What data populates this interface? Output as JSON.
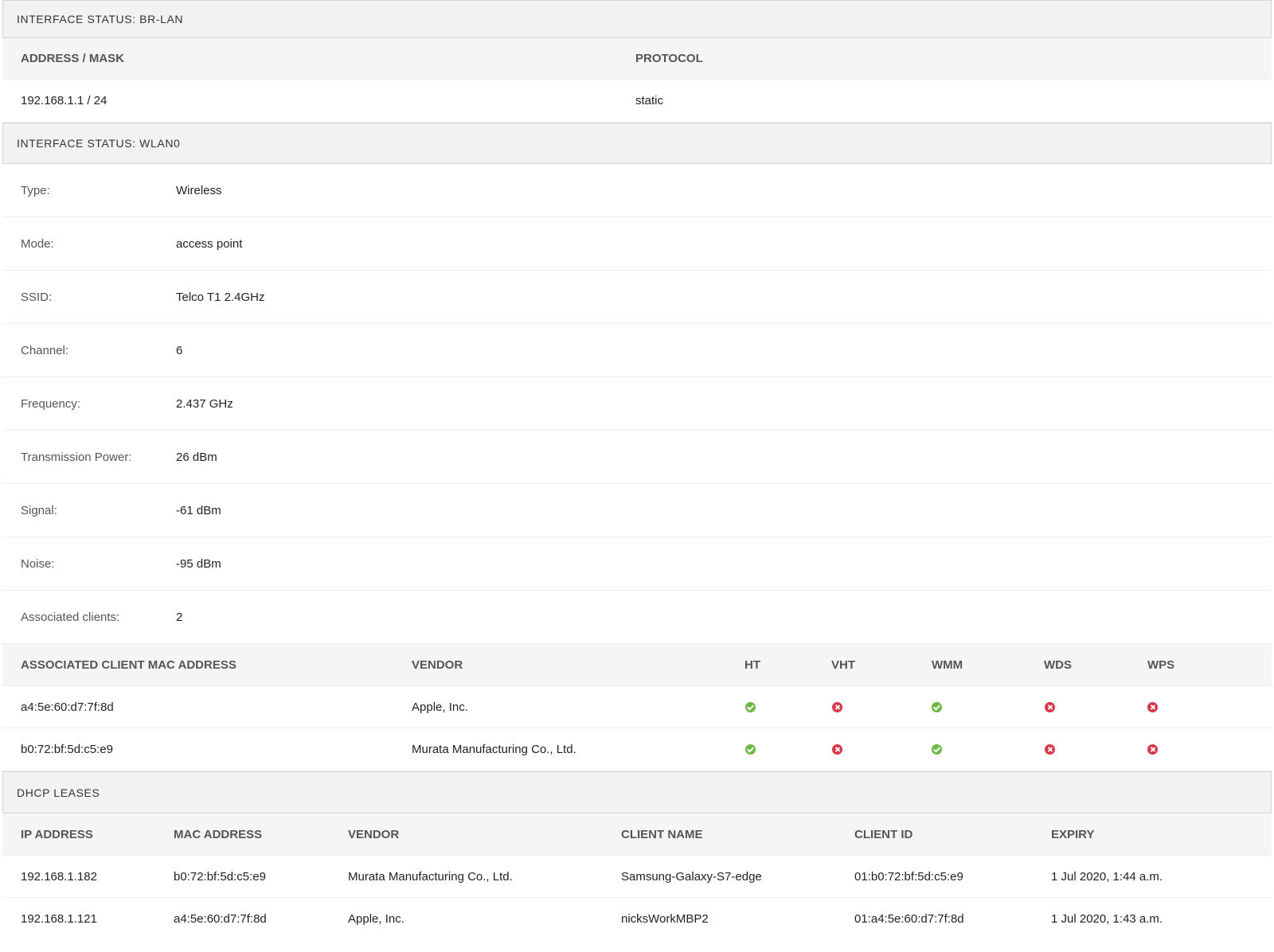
{
  "br_lan": {
    "title": "INTERFACE STATUS: BR-LAN",
    "headers": {
      "address": "ADDRESS / MASK",
      "protocol": "PROTOCOL"
    },
    "rows": [
      {
        "address": "192.168.1.1 / 24",
        "protocol": "static"
      }
    ]
  },
  "wlan0": {
    "title": "INTERFACE STATUS: WLAN0",
    "fields": [
      {
        "label": "Type:",
        "value": "Wireless"
      },
      {
        "label": "Mode:",
        "value": "access point"
      },
      {
        "label": "SSID:",
        "value": "Telco T1 2.4GHz"
      },
      {
        "label": "Channel:",
        "value": "6"
      },
      {
        "label": "Frequency:",
        "value": "2.437 GHz"
      },
      {
        "label": "Transmission Power:",
        "value": "26 dBm"
      },
      {
        "label": "Signal:",
        "value": "-61 dBm"
      },
      {
        "label": "Noise:",
        "value": "-95 dBm"
      },
      {
        "label": "Associated clients:",
        "value": "2"
      }
    ]
  },
  "clients": {
    "headers": {
      "mac": "ASSOCIATED CLIENT MAC ADDRESS",
      "vendor": "VENDOR",
      "ht": "HT",
      "vht": "VHT",
      "wmm": "WMM",
      "wds": "WDS",
      "wps": "WPS"
    },
    "rows": [
      {
        "mac": "a4:5e:60:d7:7f:8d",
        "vendor": "Apple, Inc.",
        "ht": "check-circle-icon",
        "vht": "x-circle-icon",
        "wmm": "check-circle-icon",
        "wds": "x-circle-icon",
        "wps": "x-circle-icon"
      },
      {
        "mac": "b0:72:bf:5d:c5:e9",
        "vendor": "Murata Manufacturing Co., Ltd.",
        "ht": "check-circle-icon",
        "vht": "x-circle-icon",
        "wmm": "check-circle-icon",
        "wds": "x-circle-icon",
        "wps": "x-circle-icon"
      }
    ]
  },
  "dhcp": {
    "title": "DHCP LEASES",
    "headers": {
      "ip": "IP ADDRESS",
      "mac": "MAC ADDRESS",
      "vendor": "VENDOR",
      "name": "CLIENT NAME",
      "id": "CLIENT ID",
      "expiry": "EXPIRY"
    },
    "rows": [
      {
        "ip": "192.168.1.182",
        "mac": "b0:72:bf:5d:c5:e9",
        "vendor": "Murata Manufacturing Co., Ltd.",
        "name": "Samsung-Galaxy-S7-edge",
        "id": "01:b0:72:bf:5d:c5:e9",
        "expiry": "1 Jul 2020, 1:44 a.m."
      },
      {
        "ip": "192.168.1.121",
        "mac": "a4:5e:60:d7:7f:8d",
        "vendor": "Apple, Inc.",
        "name": "nicksWorkMBP2",
        "id": "01:a4:5e:60:d7:7f:8d",
        "expiry": "1 Jul 2020, 1:43 a.m."
      }
    ]
  },
  "colors": {
    "ok": "#6cb842",
    "fail": "#d9364a",
    "header_bg": "#f2f2f2"
  }
}
